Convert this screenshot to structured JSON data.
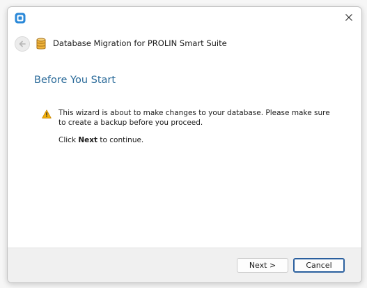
{
  "window": {
    "title": "Database Migration for PROLIN Smart Suite",
    "app_icon": "blue-rounded-app-icon",
    "close_icon": "close-icon",
    "back_icon": "back-arrow-icon",
    "title_icon": "database-icon"
  },
  "content": {
    "heading": "Before You Start",
    "warning_icon": "warning-icon",
    "warning_text": "This wizard is about to make changes to your database. Please make sure to create a backup before you proceed.",
    "continue_prefix": "Click ",
    "continue_bold": "Next",
    "continue_suffix": " to continue."
  },
  "footer": {
    "next_label": "Next >",
    "cancel_label": "Cancel"
  },
  "colors": {
    "heading": "#2a6a99",
    "accent": "#2a5f9e",
    "warning": "#f2b00b"
  }
}
